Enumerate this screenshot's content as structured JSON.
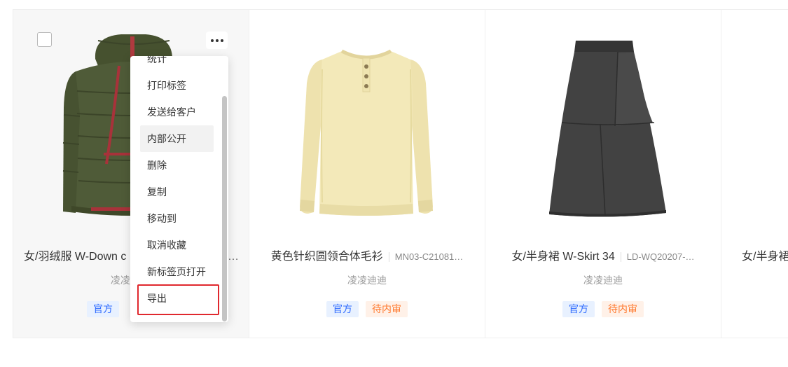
{
  "colors": {
    "card_hover_bg": "#f7f7f7",
    "tag_official_bg": "#e8f1ff",
    "tag_official_text": "#2e6bff",
    "tag_pending_bg": "#fff1e8",
    "tag_pending_text": "#ff7a30",
    "highlight_border": "#e0282e",
    "title_text": "#333333",
    "muted_text": "#999999"
  },
  "icons": {
    "more": "more-horizontal-icon",
    "checkbox": "checkbox-icon"
  },
  "cards": [
    {
      "selected": false,
      "title": "女/羽绒服 W-Down c",
      "title_tail": "…",
      "creator": "凌凌",
      "tags": [
        "官方"
      ]
    },
    {
      "title": "黄色针织圆领合体毛衫",
      "code": "MN03-C21081…",
      "creator": "凌凌迪迪",
      "tags": [
        "官方",
        "待内审"
      ]
    },
    {
      "title": "女/半身裙 W-Skirt 34",
      "code": "LD-WQ20207-…",
      "creator": "凌凌迪迪",
      "tags": [
        "官方",
        "待内审"
      ]
    },
    {
      "title": "女/半身裙"
    }
  ],
  "context_menu": {
    "items": [
      "统计",
      "打印标签",
      "发送给客户",
      "内部公开",
      "删除",
      "复制",
      "移动到",
      "取消收藏",
      "新标签页打开",
      "导出"
    ],
    "hovered_item": "内部公开",
    "highlighted_item": "导出"
  }
}
